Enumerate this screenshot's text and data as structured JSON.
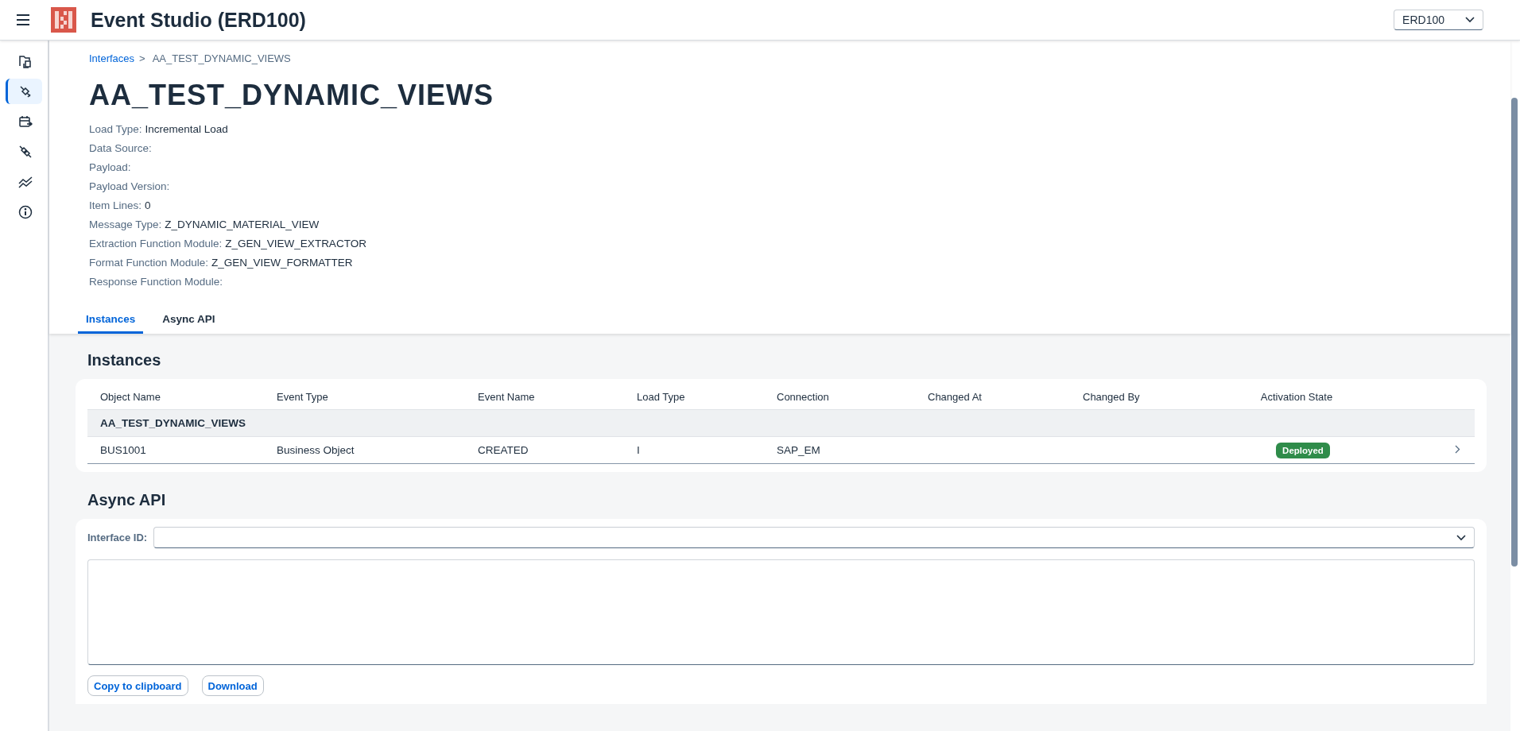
{
  "header": {
    "title": "Event Studio (ERD100)",
    "system_select": {
      "value": "ERD100"
    }
  },
  "sidebar": {
    "items": [
      {
        "kind": "documents",
        "selected": false
      },
      {
        "kind": "plug",
        "selected": true
      },
      {
        "kind": "calendar",
        "selected": false
      },
      {
        "kind": "unplug",
        "selected": false
      },
      {
        "kind": "trend",
        "selected": false
      },
      {
        "kind": "info",
        "selected": false
      }
    ]
  },
  "breadcrumb": {
    "link": "Interfaces",
    "separator": ">",
    "current": "AA_TEST_DYNAMIC_VIEWS"
  },
  "page_title": "AA_TEST_DYNAMIC_VIEWS",
  "attributes": [
    {
      "label": "Load Type:",
      "value": "Incremental Load"
    },
    {
      "label": "Data Source:"
    },
    {
      "label": "Payload:"
    },
    {
      "label": "Payload Version:"
    },
    {
      "label": "Item Lines:",
      "value": "0"
    },
    {
      "label": "Message Type:",
      "value": "Z_DYNAMIC_MATERIAL_VIEW"
    },
    {
      "label": "Extraction Function Module:",
      "value": "Z_GEN_VIEW_EXTRACTOR"
    },
    {
      "label": "Format Function Module:",
      "value": "Z_GEN_VIEW_FORMATTER"
    },
    {
      "label": "Response Function Module:"
    }
  ],
  "tabs": [
    {
      "label": "Instances",
      "selected": true
    },
    {
      "label": "Async API",
      "selected": false
    }
  ],
  "instances": {
    "heading": "Instances",
    "table": {
      "columns": [
        "Object Name",
        "Event Type",
        "Event Name",
        "Load Type",
        "Connection",
        "Changed At",
        "Changed By",
        "Activation State"
      ],
      "rows": [
        {
          "kind": "group",
          "title": "AA_TEST_DYNAMIC_VIEWS"
        },
        {
          "kind": "item",
          "cells": [
            "BUS1001",
            "Business Object",
            "CREATED",
            "I",
            "SAP_EM",
            "",
            ""
          ],
          "status": {
            "label": "Deployed",
            "color": "#2f8c4a"
          }
        }
      ]
    }
  },
  "async_api": {
    "heading": "Async API",
    "interface_id_label": "Interface ID:",
    "buttons": [
      "Copy to clipboard",
      "Download"
    ]
  }
}
